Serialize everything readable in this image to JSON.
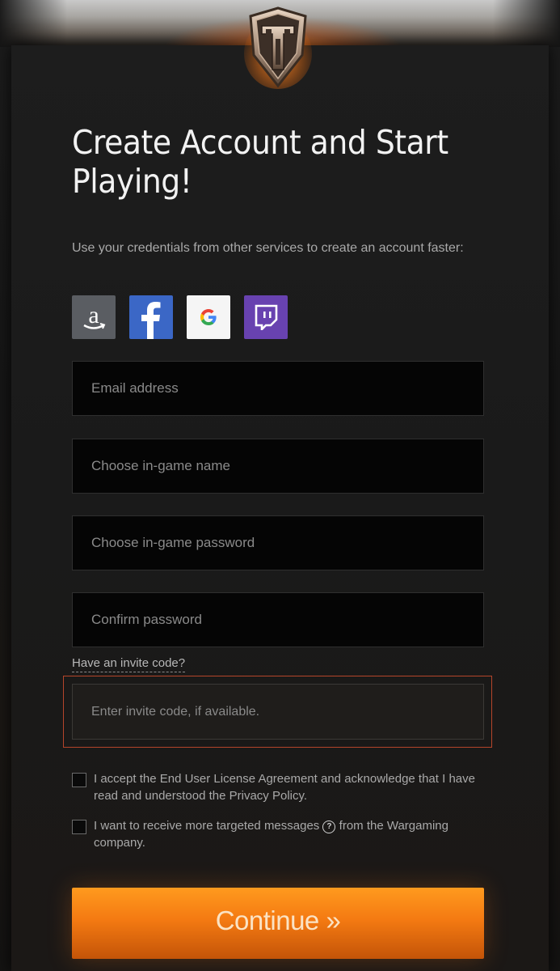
{
  "header": {
    "logo_icon": "world-of-tanks-shield-icon"
  },
  "title": "Create Account and Start Playing!",
  "subtitle": "Use your credentials from other services to create an account faster:",
  "social_logins": [
    {
      "name": "amazon",
      "icon": "amazon-icon",
      "color": "#5a5d62"
    },
    {
      "name": "facebook",
      "icon": "facebook-icon",
      "color": "#3b67c6"
    },
    {
      "name": "google",
      "icon": "google-icon",
      "color": "#f5f5f5"
    },
    {
      "name": "twitch",
      "icon": "twitch-icon",
      "color": "#6842b0"
    }
  ],
  "form": {
    "email_placeholder": "Email address",
    "name_placeholder": "Choose in-game name",
    "password_placeholder": "Choose in-game password",
    "confirm_placeholder": "Confirm password",
    "invite_link": "Have an invite code?",
    "invite_placeholder": "Enter invite code, if available."
  },
  "checkboxes": {
    "eula": "I accept the End User License Agreement and acknowledge that I have read and understood the Privacy Policy.",
    "marketing_before": "I want to receive more targeted messages",
    "marketing_help_icon": "question-circle-icon",
    "marketing_after": "from the Wargaming company."
  },
  "continue_label": "Continue »",
  "colors": {
    "accent_orange": "#f47a12",
    "invite_highlight": "#b5452a",
    "field_bg": "#050505"
  }
}
